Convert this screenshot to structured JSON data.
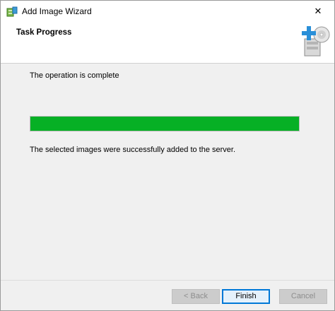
{
  "window": {
    "title": "Add Image Wizard",
    "close_glyph": "✕"
  },
  "header": {
    "title": "Task Progress"
  },
  "content": {
    "status": "The operation is complete",
    "progress_fraction": 1.0,
    "result": "The selected images were successfully added to the server."
  },
  "buttons": {
    "back": "< Back",
    "finish": "Finish",
    "cancel": "Cancel"
  },
  "colors": {
    "progress": "#06b025"
  }
}
